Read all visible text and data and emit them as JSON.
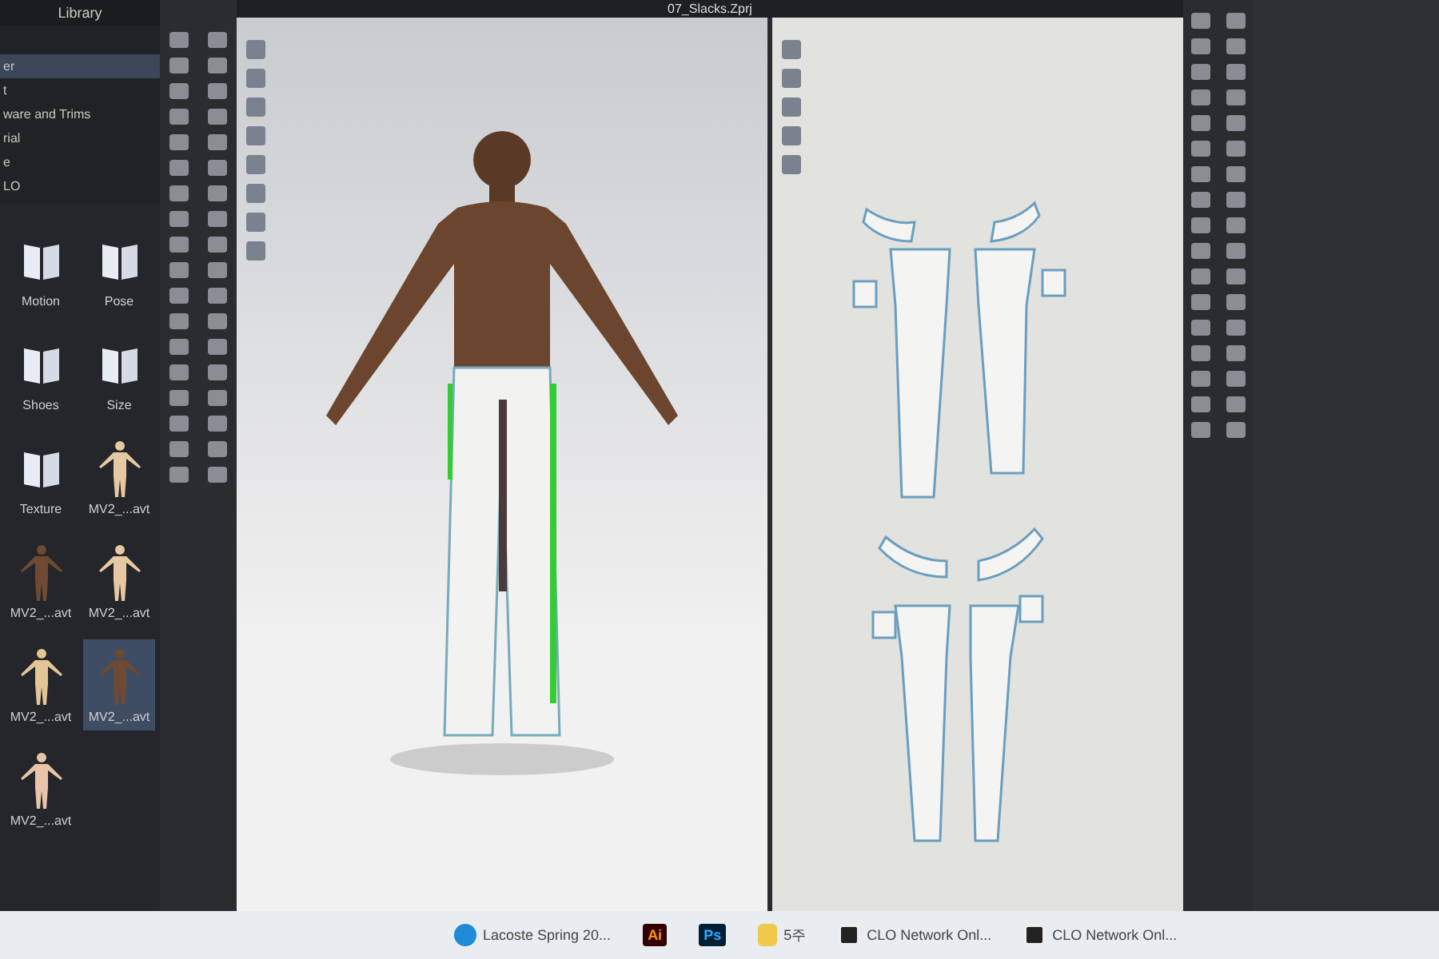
{
  "library": {
    "title": "Library",
    "tree": [
      {
        "label": "er",
        "selected": true
      },
      {
        "label": "t",
        "selected": false
      },
      {
        "label": "ware and Trims",
        "selected": false
      },
      {
        "label": "rial",
        "selected": false
      },
      {
        "label": "e",
        "selected": false
      },
      {
        "label": "LO",
        "selected": false
      }
    ],
    "items": [
      {
        "kind": "folder",
        "label": "Motion",
        "selected": false
      },
      {
        "kind": "folder",
        "label": "Pose",
        "selected": false
      },
      {
        "kind": "folder",
        "label": "Shoes",
        "selected": false
      },
      {
        "kind": "folder",
        "label": "Size",
        "selected": false
      },
      {
        "kind": "folder",
        "label": "Texture",
        "selected": false
      },
      {
        "kind": "avatar",
        "label": "MV2_...avt",
        "color": "#e6c9a2",
        "selected": false
      },
      {
        "kind": "avatar",
        "label": "MV2_...avt",
        "color": "#6e4a32",
        "selected": false
      },
      {
        "kind": "avatar",
        "label": "MV2_...avt",
        "color": "#e6c9a2",
        "selected": false
      },
      {
        "kind": "avatar",
        "label": "MV2_...avt",
        "color": "#e3c596",
        "selected": false
      },
      {
        "kind": "avatar",
        "label": "MV2_...avt",
        "color": "#6e4a32",
        "selected": true
      },
      {
        "kind": "avatar",
        "label": "MV2_...avt",
        "color": "#e8c4a8",
        "selected": false
      }
    ]
  },
  "window": {
    "title": "07_Slacks.Zprj"
  },
  "taskbar": [
    {
      "kind": "edge",
      "label": "Lacoste Spring 20..."
    },
    {
      "kind": "ai",
      "label": "Ai"
    },
    {
      "kind": "ps",
      "label": "Ps"
    },
    {
      "kind": "folder",
      "label": "5주"
    },
    {
      "kind": "clo",
      "label": "CLO Network Onl..."
    },
    {
      "kind": "clo",
      "label": "CLO Network Onl..."
    }
  ]
}
